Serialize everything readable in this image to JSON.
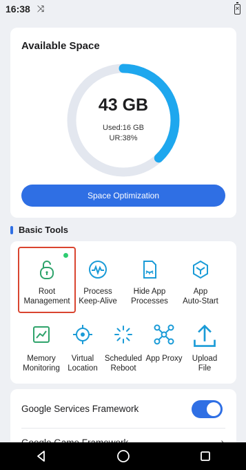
{
  "status_bar": {
    "time": "16:38"
  },
  "space": {
    "title": "Available Space",
    "available": "43 GB",
    "used_label": "Used:16 GB",
    "usage_label": "UR:38%",
    "usage_fraction": 0.38,
    "optimize_label": "Space Optimization"
  },
  "tools": {
    "section_title": "Basic Tools",
    "items": [
      {
        "line1": "Root",
        "line2": "Management",
        "icon": "lock-icon"
      },
      {
        "line1": "Process",
        "line2": "Keep-Alive",
        "icon": "pulse-icon"
      },
      {
        "line1": "Hide App",
        "line2": "Processes",
        "icon": "hidden-file-icon"
      },
      {
        "line1": "App",
        "line2": "Auto-Start",
        "icon": "cube-icon"
      },
      {
        "line1": "Memory",
        "line2": "Monitoring",
        "icon": "chart-icon"
      },
      {
        "line1": "Virtual",
        "line2": "Location",
        "icon": "location-target-icon"
      },
      {
        "line1": "Scheduled",
        "line2": "Reboot",
        "icon": "loading-spinner-icon"
      },
      {
        "line1": "App Proxy",
        "line2": "",
        "icon": "network-icon"
      },
      {
        "line1": "Upload",
        "line2": "File",
        "icon": "upload-icon"
      }
    ]
  },
  "settings": {
    "gsf_label": "Google Services Framework",
    "gsf_enabled": true,
    "second_row_label": "Google Game Framework"
  },
  "colors": {
    "accent": "#2f6fe4",
    "ring": "#1ea7ee",
    "ring_track": "#e3e7ef",
    "icon": "#1a9bd7",
    "badge": "#2ecc71",
    "highlight": "#d9442f"
  }
}
